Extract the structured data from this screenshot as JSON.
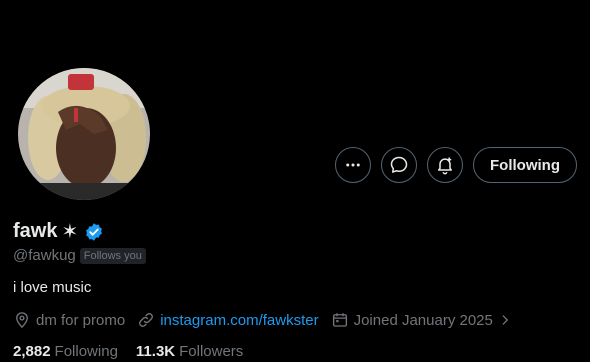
{
  "profile": {
    "display_name": "fawk",
    "name_symbol": "✶",
    "handle": "@fawkug",
    "follows_you": "Follows you",
    "bio": "i love music",
    "location": "dm for promo",
    "website": "instagram.com/fawkster",
    "joined": "Joined January 2025"
  },
  "actions": {
    "follow_label": "Following"
  },
  "stats": {
    "following_count": "2,882",
    "following_label": "Following",
    "followers_count": "11.3K",
    "followers_label": "Followers"
  },
  "icons": {
    "more": "more-icon",
    "message": "message-icon",
    "notify": "bell-icon",
    "verified": "verified-badge-icon",
    "location": "location-pin-icon",
    "link": "link-icon",
    "calendar": "calendar-icon"
  },
  "colors": {
    "background": "#000000",
    "text_primary": "#e7e9ea",
    "text_secondary": "#71767b",
    "link": "#1d9bf0",
    "verified": "#1d9bf0",
    "border": "#536471"
  }
}
